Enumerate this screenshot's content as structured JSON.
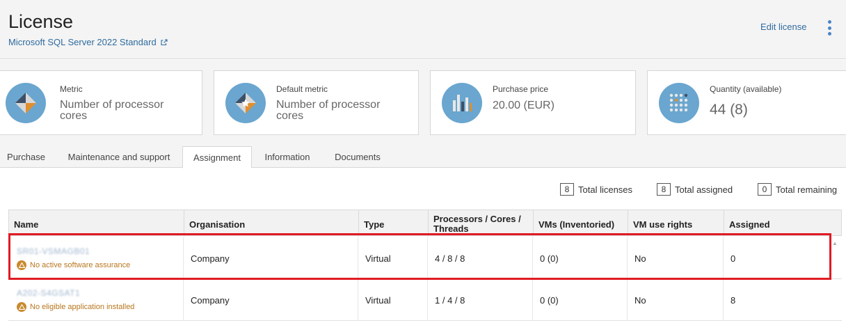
{
  "header": {
    "title": "License",
    "subtitle": "Microsoft SQL Server 2022 Standard",
    "edit_label": "Edit license"
  },
  "cards": [
    {
      "label": "Metric",
      "value": "Number of processor cores",
      "icon": "metric-icon"
    },
    {
      "label": "Default metric",
      "value": "Number of processor cores",
      "icon": "default-metric-icon"
    },
    {
      "label": "Purchase price",
      "value": "20.00 (EUR)",
      "icon": "price-chart-icon"
    },
    {
      "label": "Quantity (available)",
      "value": "44 (8)",
      "icon": "quantity-grid-icon"
    }
  ],
  "tabs": [
    {
      "label": "Purchase",
      "active": false
    },
    {
      "label": "Maintenance and support",
      "active": false
    },
    {
      "label": "Assignment",
      "active": true
    },
    {
      "label": "Information",
      "active": false
    },
    {
      "label": "Documents",
      "active": false
    }
  ],
  "totals": [
    {
      "value": "8",
      "label": "Total licenses"
    },
    {
      "value": "8",
      "label": "Total assigned"
    },
    {
      "value": "0",
      "label": "Total remaining"
    }
  ],
  "table": {
    "columns": [
      "Name",
      "Organisation",
      "Type",
      "Processors / Cores / Threads",
      "VMs (Inventoried)",
      "VM use rights",
      "Assigned"
    ],
    "rows": [
      {
        "name": "SR01-VSMAGB01",
        "warning": "No active software assurance",
        "organisation": "Company",
        "type": "Virtual",
        "pct": "4 / 8 / 8",
        "vms": "0 (0)",
        "vm_rights": "No",
        "assigned": "0"
      },
      {
        "name": "A202-S4GSAT1",
        "warning": "No eligible application installed",
        "organisation": "Company",
        "type": "Virtual",
        "pct": "1 / 4 / 8",
        "vms": "0 (0)",
        "vm_rights": "No",
        "assigned": "8"
      }
    ]
  },
  "colors": {
    "accent": "#2e6b9e",
    "icon_circle": "#6aa6cf",
    "warning": "#b8761e",
    "highlight": "#e01b24"
  }
}
